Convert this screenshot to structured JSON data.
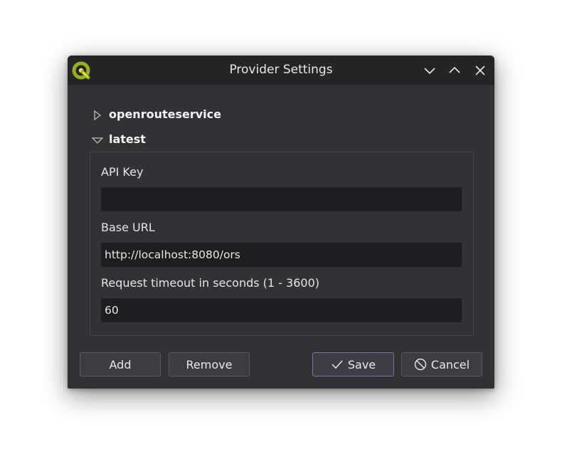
{
  "window": {
    "title": "Provider Settings"
  },
  "tree": {
    "nodes": [
      {
        "label": "openrouteservice",
        "expanded": false
      },
      {
        "label": "latest",
        "expanded": true
      }
    ]
  },
  "form": {
    "api_key": {
      "label": "API Key",
      "value": ""
    },
    "base_url": {
      "label": "Base URL",
      "value": "http://localhost:8080/ors"
    },
    "timeout": {
      "label": "Request timeout in seconds (1 - 3600)",
      "value": "60"
    }
  },
  "buttons": {
    "add": "Add",
    "remove": "Remove",
    "save": "Save",
    "cancel": "Cancel"
  },
  "colors": {
    "accent": "#7d6fb0",
    "qgis_green": "#93b023",
    "qgis_yellow": "#f0e64a"
  }
}
